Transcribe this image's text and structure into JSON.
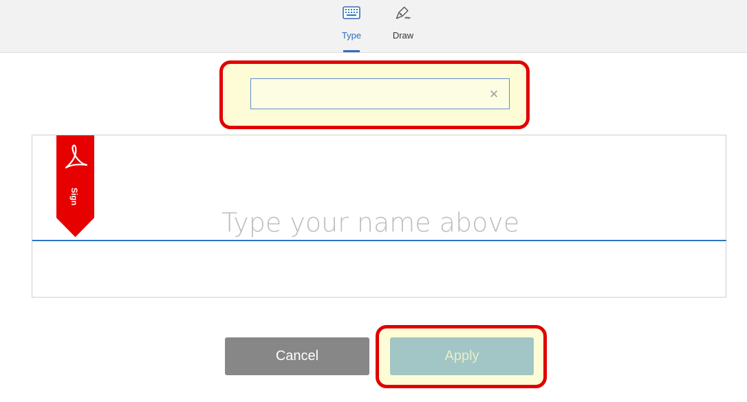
{
  "tabs": [
    {
      "label": "Type",
      "icon": "keyboard-icon",
      "active": true
    },
    {
      "label": "Draw",
      "icon": "pen-draw-icon",
      "active": false
    }
  ],
  "name_input": {
    "value": "",
    "clear_symbol": "×"
  },
  "signature_panel": {
    "placeholder": "Type your name above",
    "badge_text": "Sign"
  },
  "buttons": {
    "cancel": "Cancel",
    "apply": "Apply"
  },
  "colors": {
    "accent": "#2d6fba",
    "highlight_border": "#e10000",
    "highlight_fill": "#fefcd6",
    "sign_badge": "#e60000",
    "cancel_bg": "#878787",
    "apply_bg": "#a2c5c5"
  }
}
